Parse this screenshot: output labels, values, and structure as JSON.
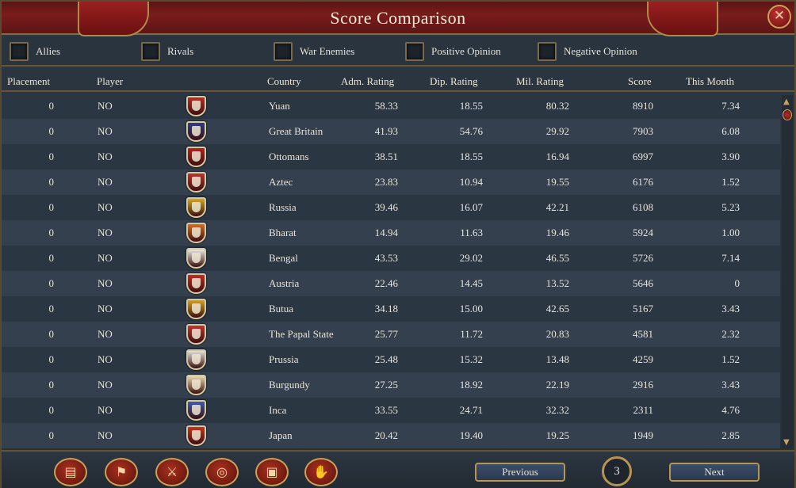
{
  "window": {
    "title": "Score Comparison"
  },
  "filters": [
    "Allies",
    "Rivals",
    "War Enemies",
    "Positive Opinion",
    "Negative Opinion"
  ],
  "columns": {
    "placement": "Placement",
    "player": "Player",
    "country": "Country",
    "adm": "Adm. Rating",
    "dip": "Dip. Rating",
    "mil": "Mil. Rating",
    "score": "Score",
    "month": "This Month"
  },
  "rows": [
    {
      "placement": "0",
      "player": "NO",
      "country": "Yuan",
      "adm": "58.33",
      "dip": "18.55",
      "mil": "80.32",
      "score": "8910",
      "month": "7.34",
      "flag": "#c02a2a"
    },
    {
      "placement": "0",
      "player": "NO",
      "country": "Great Britain",
      "adm": "41.93",
      "dip": "54.76",
      "mil": "29.92",
      "score": "7903",
      "month": "6.08",
      "flag": "#2a3a8a"
    },
    {
      "placement": "0",
      "player": "NO",
      "country": "Ottomans",
      "adm": "38.51",
      "dip": "18.55",
      "mil": "16.94",
      "score": "6997",
      "month": "3.90",
      "flag": "#b82020"
    },
    {
      "placement": "0",
      "player": "NO",
      "country": "Aztec",
      "adm": "23.83",
      "dip": "10.94",
      "mil": "19.55",
      "score": "6176",
      "month": "1.52",
      "flag": "#c03030"
    },
    {
      "placement": "0",
      "player": "NO",
      "country": "Russia",
      "adm": "39.46",
      "dip": "16.07",
      "mil": "42.21",
      "score": "6108",
      "month": "5.23",
      "flag": "#d4a820"
    },
    {
      "placement": "0",
      "player": "NO",
      "country": "Bharat",
      "adm": "14.94",
      "dip": "11.63",
      "mil": "19.46",
      "score": "5924",
      "month": "1.00",
      "flag": "#d86a20"
    },
    {
      "placement": "0",
      "player": "NO",
      "country": "Bengal",
      "adm": "43.53",
      "dip": "29.02",
      "mil": "46.55",
      "score": "5726",
      "month": "7.14",
      "flag": "#e8e8e8"
    },
    {
      "placement": "0",
      "player": "NO",
      "country": "Austria",
      "adm": "22.46",
      "dip": "14.45",
      "mil": "13.52",
      "score": "5646",
      "month": "0",
      "flag": "#c82828"
    },
    {
      "placement": "0",
      "player": "NO",
      "country": "Butua",
      "adm": "34.18",
      "dip": "15.00",
      "mil": "42.65",
      "score": "5167",
      "month": "3.43",
      "flag": "#d8a020"
    },
    {
      "placement": "0",
      "player": "NO",
      "country": "The Papal State",
      "adm": "25.77",
      "dip": "11.72",
      "mil": "20.83",
      "score": "4581",
      "month": "2.32",
      "flag": "#c83030"
    },
    {
      "placement": "0",
      "player": "NO",
      "country": "Prussia",
      "adm": "25.48",
      "dip": "15.32",
      "mil": "13.48",
      "score": "4259",
      "month": "1.52",
      "flag": "#e0e0e0"
    },
    {
      "placement": "0",
      "player": "NO",
      "country": "Burgundy",
      "adm": "27.25",
      "dip": "18.92",
      "mil": "22.19",
      "score": "2916",
      "month": "3.43",
      "flag": "#e8d8b0"
    },
    {
      "placement": "0",
      "player": "NO",
      "country": "Inca",
      "adm": "33.55",
      "dip": "24.71",
      "mil": "32.32",
      "score": "2311",
      "month": "4.76",
      "flag": "#3a5ab0"
    },
    {
      "placement": "0",
      "player": "NO",
      "country": "Japan",
      "adm": "20.42",
      "dip": "19.40",
      "mil": "19.25",
      "score": "1949",
      "month": "2.85",
      "flag": "#c83020"
    }
  ],
  "footer": {
    "tabs": [
      "ledger-icon",
      "flag-icon",
      "crossed-swords-icon",
      "coins-icon",
      "crate-icon",
      "handshake-icon"
    ],
    "tab_glyphs": [
      "▤",
      "⚑",
      "⚔",
      "◎",
      "▣",
      "✋"
    ],
    "previous": "Previous",
    "page": "3",
    "next": "Next"
  }
}
